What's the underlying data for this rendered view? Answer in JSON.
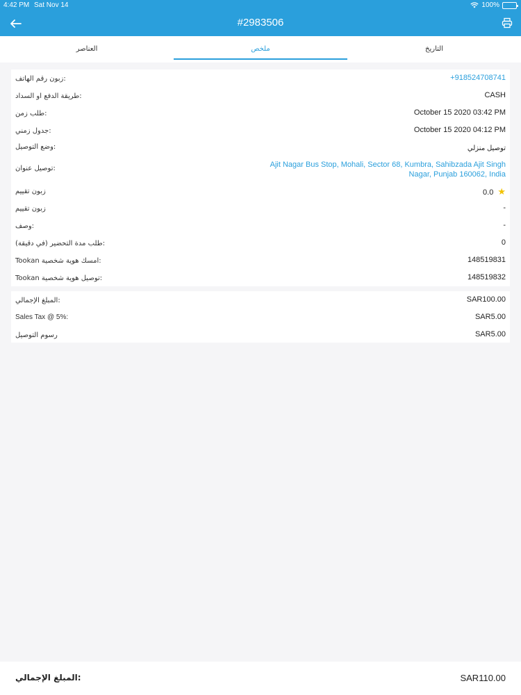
{
  "status_bar": {
    "time": "4:42 PM",
    "date": "Sat Nov 14",
    "battery": "100%"
  },
  "header": {
    "title": "#2983506",
    "back_icon": "arrow-left-icon",
    "print_icon": "printer-icon",
    "accent_color": "#2a9fdc"
  },
  "tabs": [
    {
      "label": "العناصر",
      "active": false
    },
    {
      "label": "ملخص",
      "active": true
    },
    {
      "label": "التاريخ",
      "active": false
    }
  ],
  "details": [
    {
      "label": "زبون رقم الهاتف:",
      "value": "+918524708741",
      "type": "link"
    },
    {
      "label": "طريقة الدفع او السداد:",
      "value": "CASH"
    },
    {
      "label": "طلب زمن:",
      "value": "October 15 2020 03:42 PM"
    },
    {
      "label": "جدول زمني:",
      "value": "October 15 2020 04:12 PM"
    },
    {
      "label": "وضع التوصيل:",
      "value": "توصيل منزلي"
    },
    {
      "label": "توصيل عنوان:",
      "value": "Ajit Nagar Bus Stop, Mohali, Sector 68, Kumbra, Sahibzada Ajit Singh Nagar, Punjab 160062, India",
      "type": "address"
    },
    {
      "label": "زبون تقييم",
      "value": "0.0",
      "type": "rating"
    },
    {
      "label": "زبون تقييم",
      "value": "-"
    },
    {
      "label": "وصف:",
      "value": "-"
    },
    {
      "label": "طلب مدة التحضير (في دقيقة):",
      "value": "0"
    },
    {
      "label": "Tookan امسك هوية شخصية:",
      "value": "148519831"
    },
    {
      "label": "Tookan توصيل هوية شخصية:",
      "value": "148519832"
    }
  ],
  "amounts": [
    {
      "label": "المبلغ الإجمالي:",
      "value": "SAR100.00"
    },
    {
      "label": "Sales Tax @ 5%:",
      "value": "SAR5.00"
    },
    {
      "label": "رسوم التوصيل",
      "value": "SAR5.00"
    }
  ],
  "footer": {
    "label": "المبلغ الإجمالي:",
    "value": "SAR110.00"
  }
}
